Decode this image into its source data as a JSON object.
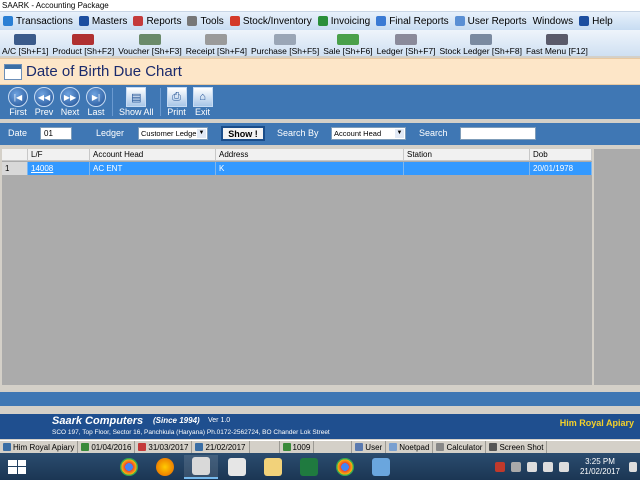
{
  "window": {
    "title": "SAARK - Accounting Package"
  },
  "menu": [
    {
      "label": "Transactions",
      "icon": "transactions-icon",
      "color": "#2a7fd4"
    },
    {
      "label": "Masters",
      "icon": "masters-icon",
      "color": "#1d4fa0"
    },
    {
      "label": "Reports",
      "icon": "reports-icon",
      "color": "#c43a3a"
    },
    {
      "label": "Tools",
      "icon": "tools-icon",
      "color": "#777777"
    },
    {
      "label": "Stock/Inventory",
      "icon": "stock-icon",
      "color": "#d43a2a"
    },
    {
      "label": "Invoicing",
      "icon": "invoicing-icon",
      "color": "#2a8f3a"
    },
    {
      "label": "Final Reports",
      "icon": "final-reports-icon",
      "color": "#3a7ad4"
    },
    {
      "label": "User Reports",
      "icon": "user-reports-icon",
      "color": "#5a8fd4"
    },
    {
      "label": "Windows",
      "icon": "",
      "color": ""
    },
    {
      "label": "Help",
      "icon": "help-icon",
      "color": "#1d4fa0"
    }
  ],
  "toolbar": [
    {
      "label": "A/C [Sh+F1]",
      "icon": "account-icon",
      "color": "#3a5a8a"
    },
    {
      "label": "Product [Sh+F2]",
      "icon": "product-icon",
      "color": "#b03030"
    },
    {
      "label": "Voucher [Sh+F3]",
      "icon": "voucher-icon",
      "color": "#6a8a6a"
    },
    {
      "label": "Receipt [Sh+F4]",
      "icon": "receipt-icon",
      "color": "#9a9a9a"
    },
    {
      "label": "Purchase [Sh+F5]",
      "icon": "purchase-icon",
      "color": "#9aa6b6"
    },
    {
      "label": "Sale [Sh+F6]",
      "icon": "sale-icon",
      "color": "#4aa04a"
    },
    {
      "label": "Ledger [Sh+F7]",
      "icon": "ledger-icon",
      "color": "#8a8a9a"
    },
    {
      "label": "Stock Ledger [Sh+F8]",
      "icon": "stock-ledger-icon",
      "color": "#7a8aa0"
    },
    {
      "label": "Fast Menu [F12]",
      "icon": "fast-menu-icon",
      "color": "#5a5a6a"
    }
  ],
  "page": {
    "title": "Date of Birth Due Chart"
  },
  "nav": {
    "first": "First",
    "prev": "Prev",
    "next": "Next",
    "last": "Last",
    "show_all": "Show All",
    "print": "Print",
    "exit": "Exit"
  },
  "filters": {
    "date_label": "Date",
    "date_value": "01",
    "ledger_label": "Ledger",
    "ledger_value": "Customer Ledge",
    "show_button": "Show !",
    "search_by_label": "Search By",
    "search_by_value": "Account Head",
    "search_label": "Search",
    "search_value": ""
  },
  "grid": {
    "columns": [
      "L/F",
      "Account Head",
      "Address",
      "Station",
      "Dob"
    ],
    "rows": [
      {
        "num": "1",
        "lf": "14008",
        "account_head": "AC ENT",
        "address": "K",
        "station": "",
        "dob": "20/01/1978"
      }
    ]
  },
  "footer": {
    "company": "Saark Computers",
    "since": "(Since 1994)",
    "version": "Ver 1.0",
    "address": "SCO 197, Top Floor, Sector 16, Panchkula (Haryana) Ph.0172-2562724,  BO Chander Lok Street",
    "firm": "Him Royal Apiary"
  },
  "status": {
    "firm": "Him Royal Apiary",
    "from_date": "01/04/2016",
    "to_date": "31/03/2017",
    "today": "21/02/2017",
    "counter": "1009",
    "user": "User",
    "notepad": "Noetpad",
    "calculator": "Calculator",
    "screenshot": "Screen Shot"
  },
  "taskbar": {
    "time": "3:25 PM",
    "date": "21/02/2017"
  }
}
